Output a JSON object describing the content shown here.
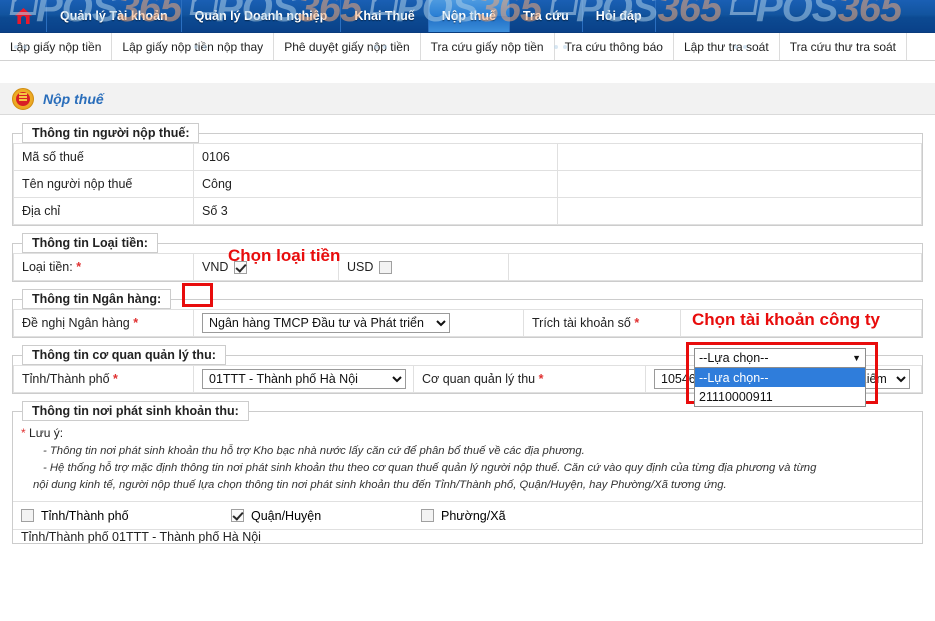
{
  "topnav": {
    "home_icon": "home-icon",
    "items": [
      {
        "label": "Quản lý Tài khoản",
        "active": false
      },
      {
        "label": "Quản lý Doanh nghiệp",
        "active": false
      },
      {
        "label": "Khai Thuế",
        "active": false
      },
      {
        "label": "Nộp thuế",
        "active": true
      },
      {
        "label": "Tra cứu",
        "active": false
      },
      {
        "label": "Hỏi đáp",
        "active": false
      }
    ]
  },
  "subnav": {
    "items": [
      {
        "label": "Lập giấy nộp tiền"
      },
      {
        "label": "Lập giấy nộp tiền nộp thay"
      },
      {
        "label": "Phê duyệt giấy nộp tiền"
      },
      {
        "label": "Tra cứu giấy nộp tiền"
      },
      {
        "label": "Tra cứu thông báo"
      },
      {
        "label": "Lập thư tra soát"
      },
      {
        "label": "Tra cứu thư tra soát"
      }
    ]
  },
  "watermark": {
    "text_part1": "POS",
    "text_part2": "365"
  },
  "page": {
    "title": "Nộp thuế",
    "seal_icon": "national-emblem-seal-icon"
  },
  "taxpayer_section": {
    "legend": "Thông tin người nộp thuế:",
    "rows": [
      {
        "label": "Mã số thuế",
        "value": "0106"
      },
      {
        "label": "Tên người nộp thuế",
        "value": "Công"
      },
      {
        "label": "Địa chỉ",
        "value": "Số 3"
      }
    ]
  },
  "currency_section": {
    "legend": "Thông tin Loại tiền:",
    "label": "Loại tiền:",
    "required_mark": "*",
    "options": [
      {
        "label": "VND",
        "checked": true
      },
      {
        "label": "USD",
        "checked": false
      }
    ],
    "annotation": "Chọn loại tiền"
  },
  "bank_section": {
    "legend": "Thông tin Ngân hàng:",
    "bank_label": "Đề nghị Ngân hàng",
    "bank_required": "*",
    "bank_value": "Ngân hàng TMCP Đầu tư và Phát triển",
    "account_label": "Trích tài khoản số",
    "account_required": "*",
    "account_placeholder": "--Lựa chọn--",
    "account_options": [
      {
        "label": "--Lựa chọn--",
        "selected": true
      },
      {
        "label": "21110000911",
        "selected": false
      }
    ],
    "annotation": "Chọn tài khoản công ty"
  },
  "authority_section": {
    "legend": "Thông tin cơ quan quản lý thu:",
    "province_label": "Tỉnh/Thành phố",
    "province_required": "*",
    "province_value": "01TTT - Thành phố Hà Nội",
    "office_label": "Cơ quan quản lý thu",
    "office_required": "*",
    "office_value": "1054633 - Chi cục thuế quận Hoàn Kiếm"
  },
  "origin_section": {
    "legend": "Thông tin nơi phát sinh khoản thu:",
    "note_star": "*",
    "note_title": "Lưu ý:",
    "note_lines": [
      "- Thông tin nơi phát sinh khoản thu hỗ trợ Kho bạc nhà nước lấy căn cứ để phân bổ thuế về các địa phương.",
      "- Hệ thống hỗ trợ mặc định thông tin nơi phát sinh khoản thu theo cơ quan thuế quản lý người nộp thuế. Căn cứ vào quy định của từng địa phương và từng",
      "nội dung kinh tế, người nộp thuế lựa chọn thông tin nơi phát sinh khoản thu đến Tỉnh/Thành phố, Quận/Huyện, hay Phường/Xã tương ứng."
    ],
    "scope_options": [
      {
        "label": "Tỉnh/Thành phố",
        "checked": false
      },
      {
        "label": "Quận/Huyện",
        "checked": true
      },
      {
        "label": "Phường/Xã",
        "checked": false
      }
    ],
    "clipped_row_text": "Tỉnh/Thành phố 01TTT - Thành phố Hà Nội"
  },
  "colors": {
    "nav_blue": "#0c4a92",
    "active_tab_blue": "#2a7fd4",
    "annotation_red": "#e80c0c",
    "title_blue": "#2a6ebb",
    "required_red": "#e03030",
    "dropdown_select_blue": "#2f7ddb"
  }
}
